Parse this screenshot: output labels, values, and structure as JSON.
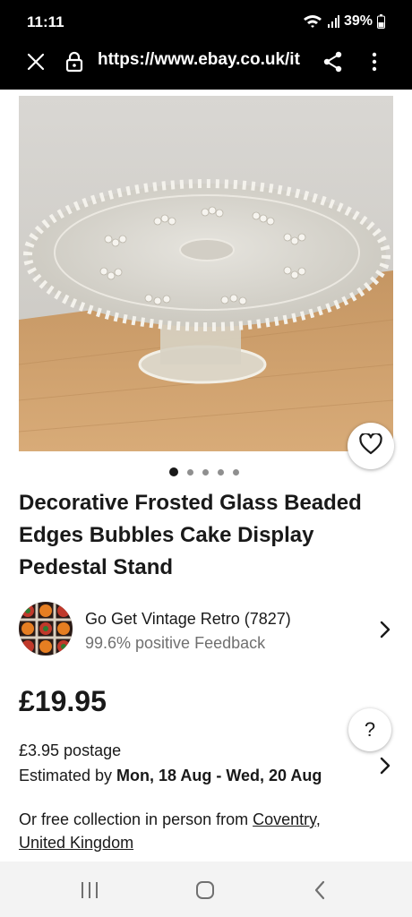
{
  "status_bar": {
    "time": "11:11",
    "battery": "39%",
    "icons": [
      "wifi-icon",
      "signal-icon",
      "battery-icon"
    ]
  },
  "browser": {
    "url": "https://www.ebay.co.uk/it",
    "icons": [
      "close-icon",
      "lock-icon",
      "share-icon",
      "more-vert-icon"
    ]
  },
  "gallery": {
    "image_alt": "Decorative frosted glass cake stand with beaded edges",
    "dot_count": 5,
    "active_index": 0,
    "wishlist_icon": "heart-outline-icon"
  },
  "product": {
    "title": "Decorative Frosted Glass Beaded Edges Bubbles Cake Display Pedestal Stand"
  },
  "seller": {
    "name": "Go Get Vintage Retro (7827)",
    "feedback": "99.6% positive Feedback"
  },
  "pricing": {
    "price": "£19.95",
    "postage": "£3.95 postage",
    "estimated_prefix": "Estimated by ",
    "estimated_dates": "Mon, 18 Aug - Wed, 20 Aug"
  },
  "collection": {
    "prefix": "Or free collection in person from ",
    "city": "Coventry",
    "separator": ",",
    "country": "United Kingdom"
  },
  "help": {
    "label": "?"
  },
  "colors": {
    "text": "#191919",
    "muted": "#707070",
    "bar": "#000000",
    "nav": "#f3f3f3"
  }
}
